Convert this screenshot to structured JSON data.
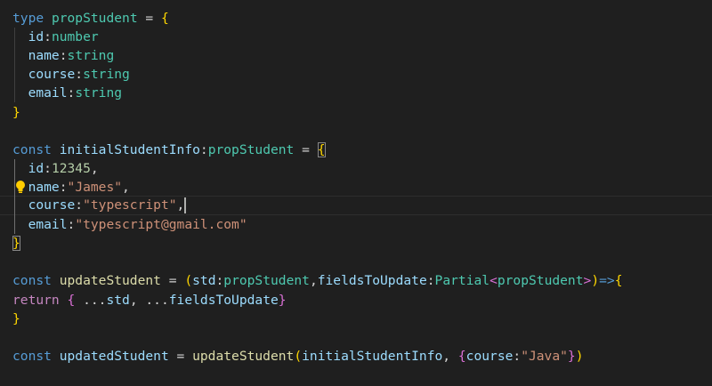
{
  "code": {
    "lines": [
      [
        {
          "t": "type",
          "c": "kw"
        },
        {
          "t": " ",
          "c": "p"
        },
        {
          "t": "propStudent",
          "c": "tp"
        },
        {
          "t": " = ",
          "c": "p"
        },
        {
          "t": "{",
          "c": "b1"
        }
      ],
      [
        {
          "t": "  ",
          "c": "p"
        },
        {
          "t": "id",
          "c": "var"
        },
        {
          "t": ":",
          "c": "p"
        },
        {
          "t": "number",
          "c": "tp"
        }
      ],
      [
        {
          "t": "  ",
          "c": "p"
        },
        {
          "t": "name",
          "c": "var"
        },
        {
          "t": ":",
          "c": "p"
        },
        {
          "t": "string",
          "c": "tp"
        }
      ],
      [
        {
          "t": "  ",
          "c": "p"
        },
        {
          "t": "course",
          "c": "var"
        },
        {
          "t": ":",
          "c": "p"
        },
        {
          "t": "string",
          "c": "tp"
        }
      ],
      [
        {
          "t": "  ",
          "c": "p"
        },
        {
          "t": "email",
          "c": "var"
        },
        {
          "t": ":",
          "c": "p"
        },
        {
          "t": "string",
          "c": "tp"
        }
      ],
      [
        {
          "t": "}",
          "c": "b1"
        }
      ],
      [],
      [
        {
          "t": "const",
          "c": "kw"
        },
        {
          "t": " ",
          "c": "p"
        },
        {
          "t": "initialStudentInfo",
          "c": "var"
        },
        {
          "t": ":",
          "c": "p"
        },
        {
          "t": "propStudent",
          "c": "tp"
        },
        {
          "t": " = ",
          "c": "p"
        },
        {
          "t": "{",
          "c": "b1 bm"
        }
      ],
      [
        {
          "t": "  ",
          "c": "p"
        },
        {
          "t": "id",
          "c": "var"
        },
        {
          "t": ":",
          "c": "p"
        },
        {
          "t": "12345",
          "c": "num"
        },
        {
          "t": ",",
          "c": "p"
        }
      ],
      [
        {
          "t": "  ",
          "c": "p"
        },
        {
          "t": "name",
          "c": "var"
        },
        {
          "t": ":",
          "c": "p"
        },
        {
          "t": "\"James\"",
          "c": "str"
        },
        {
          "t": ",",
          "c": "p"
        }
      ],
      [
        {
          "t": "  ",
          "c": "p"
        },
        {
          "t": "course",
          "c": "var"
        },
        {
          "t": ":",
          "c": "p"
        },
        {
          "t": "\"typescript\"",
          "c": "str"
        },
        {
          "t": ",",
          "c": "p"
        },
        {
          "t": "",
          "c": "cursor"
        }
      ],
      [
        {
          "t": "  ",
          "c": "p"
        },
        {
          "t": "email",
          "c": "var"
        },
        {
          "t": ":",
          "c": "p"
        },
        {
          "t": "\"typescript@gmail.com\"",
          "c": "str"
        }
      ],
      [
        {
          "t": "}",
          "c": "b1 bm"
        }
      ],
      [],
      [
        {
          "t": "const",
          "c": "kw"
        },
        {
          "t": " ",
          "c": "p"
        },
        {
          "t": "updateStudent",
          "c": "fn"
        },
        {
          "t": " = ",
          "c": "p"
        },
        {
          "t": "(",
          "c": "b1"
        },
        {
          "t": "std",
          "c": "var"
        },
        {
          "t": ":",
          "c": "p"
        },
        {
          "t": "propStudent",
          "c": "tp"
        },
        {
          "t": ",",
          "c": "p"
        },
        {
          "t": "fieldsToUpdate",
          "c": "var"
        },
        {
          "t": ":",
          "c": "p"
        },
        {
          "t": "Partial",
          "c": "tp"
        },
        {
          "t": "<",
          "c": "b2"
        },
        {
          "t": "propStudent",
          "c": "tp"
        },
        {
          "t": ">",
          "c": "b2"
        },
        {
          "t": ")",
          "c": "b1"
        },
        {
          "t": "=>",
          "c": "kw"
        },
        {
          "t": "{",
          "c": "b1"
        }
      ],
      [
        {
          "t": "return",
          "c": "kw2"
        },
        {
          "t": " ",
          "c": "p"
        },
        {
          "t": "{",
          "c": "b2"
        },
        {
          "t": " ...",
          "c": "p"
        },
        {
          "t": "std",
          "c": "var"
        },
        {
          "t": ", ...",
          "c": "p"
        },
        {
          "t": "fieldsToUpdate",
          "c": "var"
        },
        {
          "t": "}",
          "c": "b2"
        }
      ],
      [
        {
          "t": "}",
          "c": "b1"
        }
      ],
      [],
      [
        {
          "t": "const",
          "c": "kw"
        },
        {
          "t": " ",
          "c": "p"
        },
        {
          "t": "updatedStudent",
          "c": "var"
        },
        {
          "t": " = ",
          "c": "p"
        },
        {
          "t": "updateStudent",
          "c": "fn"
        },
        {
          "t": "(",
          "c": "b1"
        },
        {
          "t": "initialStudentInfo",
          "c": "var"
        },
        {
          "t": ", ",
          "c": "p"
        },
        {
          "t": "{",
          "c": "b2"
        },
        {
          "t": "course",
          "c": "var"
        },
        {
          "t": ":",
          "c": "p"
        },
        {
          "t": "\"Java\"",
          "c": "str"
        },
        {
          "t": "}",
          "c": "b2"
        },
        {
          "t": ")",
          "c": "b1"
        }
      ]
    ],
    "current_line_index": 10,
    "lightbulb_line_index": 9
  },
  "icons": {
    "lightbulb": "lightbulb-icon"
  },
  "colors": {
    "background": "#1f1f1f",
    "keyword": "#569cd6",
    "control_keyword": "#c586c0",
    "type": "#4ec9b0",
    "variable": "#9cdcfe",
    "function": "#dcdcaa",
    "string": "#ce9178",
    "number": "#b5cea8",
    "bracket_level1": "#ffd700",
    "bracket_level2": "#da70d6"
  }
}
